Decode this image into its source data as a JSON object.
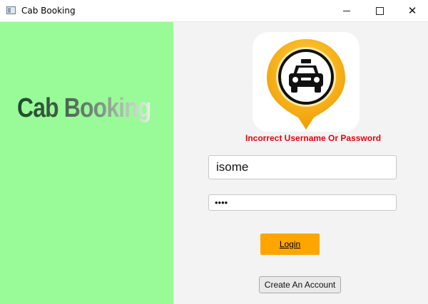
{
  "window": {
    "title": "Cab Booking",
    "minimize_icon": "minimize-icon",
    "maximize_icon": "maximize-icon",
    "close_icon": "close-icon",
    "close_glyph": "✕"
  },
  "left_panel": {
    "brand_text": "Cab Booking",
    "background": "#98fb98"
  },
  "login": {
    "logo_icon": "taxi-pin-icon",
    "error_message": "Incorrect Username Or Password",
    "username_value": "isome",
    "password_value": "abcd",
    "login_label": "Login",
    "create_account_label": "Create An Account"
  },
  "colors": {
    "accent": "#ffa500",
    "error": "#e8000b",
    "pin_yellow": "#f7b500"
  }
}
